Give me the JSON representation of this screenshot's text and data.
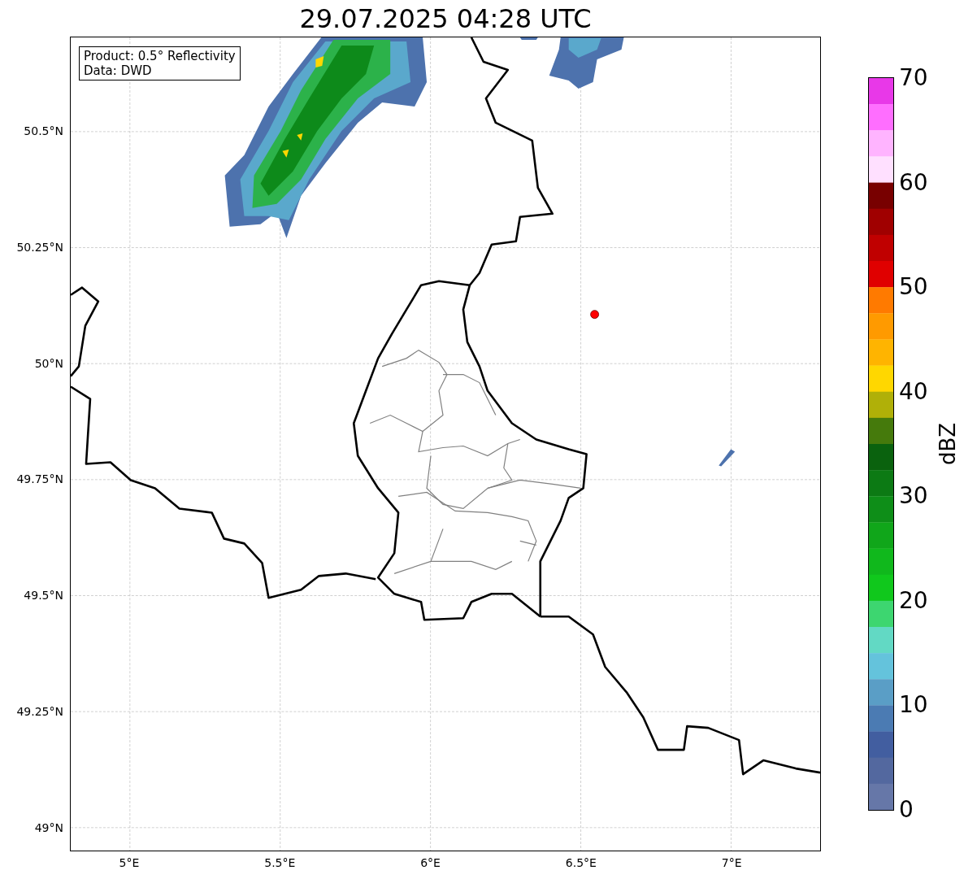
{
  "title": "29.07.2025 04:28 UTC",
  "info_box": [
    "Product: 0.5° Reflectivity",
    "Data: DWD"
  ],
  "map": {
    "yticks": [
      "50.5°N",
      "50.25°N",
      "50°N",
      "49.75°N",
      "49.5°N",
      "49.25°N",
      "49°N"
    ],
    "xticks": [
      "5°E",
      "5.5°E",
      "6°E",
      "6.5°E",
      "7°E"
    ]
  },
  "colorbar": {
    "label": "dBZ",
    "ticks": [
      "70",
      "60",
      "50",
      "40",
      "30",
      "20",
      "10",
      "0"
    ],
    "bins": [
      {
        "color": "#e838e8"
      },
      {
        "color": "#ff6eff"
      },
      {
        "color": "#ffb4ff"
      },
      {
        "color": "#ffe0ff"
      },
      {
        "color": "#780000"
      },
      {
        "color": "#a00000"
      },
      {
        "color": "#c00000"
      },
      {
        "color": "#e00000"
      },
      {
        "color": "#ff7a00"
      },
      {
        "color": "#ff9a00"
      },
      {
        "color": "#ffb400"
      },
      {
        "color": "#ffd700"
      },
      {
        "color": "#b0b008"
      },
      {
        "color": "#457a0c"
      },
      {
        "color": "#0a620e"
      },
      {
        "color": "#0c7a14"
      },
      {
        "color": "#0e8e18"
      },
      {
        "color": "#10a61a"
      },
      {
        "color": "#10b81c"
      },
      {
        "color": "#10c81c"
      },
      {
        "color": "#3dd670"
      },
      {
        "color": "#62d9c4"
      },
      {
        "color": "#64c3dc"
      },
      {
        "color": "#5a9ec6"
      },
      {
        "color": "#4b7bb3"
      },
      {
        "color": "#425ea0"
      },
      {
        "color": "#53689f"
      },
      {
        "color": "#6677a8"
      }
    ]
  }
}
